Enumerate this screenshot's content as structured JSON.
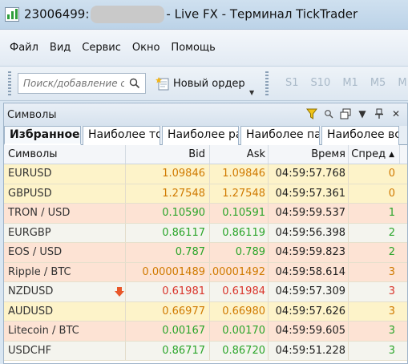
{
  "window": {
    "account": "23006499:",
    "title_suffix": "- Live FX - Терминал TickTrader"
  },
  "menu": [
    "Файл",
    "Вид",
    "Сервис",
    "Окно",
    "Помощь"
  ],
  "toolbar": {
    "search_placeholder": "Поиск/добавление с",
    "new_order_label": "Новый ордер",
    "timeframes": [
      "S1",
      "S10",
      "M1",
      "M5",
      "M"
    ]
  },
  "panel": {
    "title": "Символы",
    "tabs": [
      "Избранное",
      "Наиболее то",
      "Наиболее ра",
      "Наиболее па",
      "Наиболее вс"
    ],
    "columns": {
      "symbol": "Символы",
      "bid": "Bid",
      "ask": "Ask",
      "time": "Время",
      "spread": "Спред"
    },
    "rows": [
      {
        "symbol": "EURUSD",
        "bid": "1.09846",
        "ask": "1.09846",
        "time": "04:59:57.768",
        "spread": "0",
        "bg": "#fdf3c9",
        "color": "#d07a00"
      },
      {
        "symbol": "GBPUSD",
        "bid": "1.27548",
        "ask": "1.27548",
        "time": "04:59:57.361",
        "spread": "0",
        "bg": "#fdf3c9",
        "color": "#d07a00"
      },
      {
        "symbol": "TRON / USD",
        "bid": "0.10590",
        "ask": "0.10591",
        "time": "04:59:59.537",
        "spread": "1",
        "bg": "#fde3d4",
        "color": "#2aa52a"
      },
      {
        "symbol": "EURGBP",
        "bid": "0.86117",
        "ask": "0.86119",
        "time": "04:59:56.398",
        "spread": "2",
        "bg": "#f4f4ee",
        "color": "#2aa52a"
      },
      {
        "symbol": "EOS / USD",
        "bid": "0.787",
        "ask": "0.789",
        "time": "04:59:59.823",
        "spread": "2",
        "bg": "#fde3d4",
        "color": "#2aa52a"
      },
      {
        "symbol": "Ripple / BTC",
        "bid": "0.00001489",
        "ask": "0.00001492",
        "time": "04:59:58.614",
        "spread": "3",
        "bg": "#fde3d4",
        "color": "#d07a00"
      },
      {
        "symbol": "NZDUSD",
        "bid": "0.61981",
        "ask": "0.61984",
        "time": "04:59:57.309",
        "spread": "3",
        "bg": "#f4f4ee",
        "color": "#d9342b",
        "alert": true
      },
      {
        "symbol": "AUDUSD",
        "bid": "0.66977",
        "ask": "0.66980",
        "time": "04:59:57.626",
        "spread": "3",
        "bg": "#fdf3c9",
        "color": "#d07a00"
      },
      {
        "symbol": "Litecoin / BTC",
        "bid": "0.00167",
        "ask": "0.00170",
        "time": "04:59:59.605",
        "spread": "3",
        "bg": "#fde3d4",
        "color": "#2aa52a"
      },
      {
        "symbol": "USDCHF",
        "bid": "0.86717",
        "ask": "0.86720",
        "time": "04:59:51.228",
        "spread": "3",
        "bg": "#f4f4ee",
        "color": "#2aa52a"
      }
    ]
  }
}
